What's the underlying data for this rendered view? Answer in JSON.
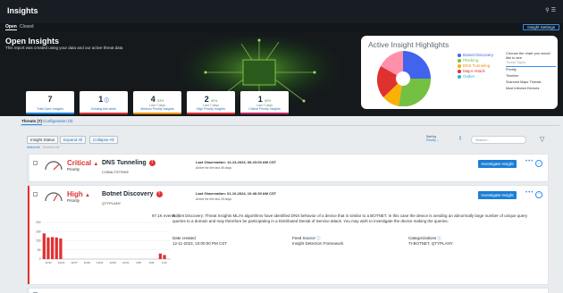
{
  "app": {
    "title": "Insights"
  },
  "header": {
    "settings_label": "Insight Settings",
    "icons": [
      "search-icon",
      "menu-icon"
    ]
  },
  "tabs": [
    {
      "label": "Open"
    },
    {
      "label": "Closed"
    }
  ],
  "hero": {
    "title": "Open Insights",
    "subtitle": "This report was created using your data and our active threat data"
  },
  "kpis": [
    {
      "value": "7",
      "delta": "",
      "delta_sub": "",
      "label": "Total Open Insights",
      "color": "#1c7ed6",
      "icon": ""
    },
    {
      "value": "1",
      "delta": "",
      "delta_sub": "",
      "label": "Existing this week",
      "color": "#e03131",
      "icon": "info-icon"
    },
    {
      "value": "4",
      "delta": "83%",
      "delta_sub": "Last 7 days",
      "label": "Medium Priority Insights",
      "color": "#f08c00",
      "icon": ""
    },
    {
      "value": "2",
      "delta": "60%",
      "delta_sub": "Last 7 days",
      "label": "High Priority Insights",
      "color": "#e03131",
      "icon": ""
    },
    {
      "value": "1",
      "delta": "60%",
      "delta_sub": "Last 7 days",
      "label": "Critical Priority Insights",
      "color": "#c2255c",
      "icon": ""
    }
  ],
  "highlights": {
    "title": "Active Insight Highlights",
    "legend": [
      {
        "label": "Botnet Discovery",
        "color": "#4263eb"
      },
      {
        "label": "Phishing",
        "color": "#74c042"
      },
      {
        "label": "DNS Tunneling",
        "color": "#fab005"
      },
      {
        "label": "Major Attack",
        "color": "#e03131"
      },
      {
        "label": "Outlier",
        "color": "#22b8cf"
      }
    ],
    "chooser_title": "Choose the chart you would like to see",
    "chooser_options": [
      "Threat Types",
      "Priority",
      "Timeline",
      "Scanned Major Threats",
      "Most Infected Devices"
    ],
    "selected": "Threat Types"
  },
  "filters": {
    "tabs": [
      "Threats (7)",
      "Configuration (0)"
    ],
    "buttons": [
      "Insight Status",
      "Expand All",
      "Collapse All"
    ],
    "links": [
      "Select All",
      "Deselect All"
    ],
    "sort_label": "Sort by",
    "sort_value": "Priority",
    "search_placeholder": "Search..."
  },
  "insights": [
    {
      "severity": "Critical",
      "priority_label": "Priority",
      "title": "DNS Tunneling",
      "tag": "COBALTSTRIKE",
      "observation": "Last Observation: 12-13-2023, 06:23:00 AM CST",
      "active": "Active for the last 40 days",
      "action": "Investigate Insight",
      "color": "#e03131"
    },
    {
      "severity": "High",
      "priority_label": "Priority",
      "title": "Botnet Discovery",
      "tag": "QTYPLANY",
      "observation": "Last Observation: 01-10-2024, 10:46:30 AM CST",
      "active": "Active for the last 29 days",
      "action": "Investigate Insight",
      "color": "#e03131",
      "events": "97.1K events",
      "description": "Botnet Discovery: Threat Insights ML/AI algorithms have identified DNS behavior of a device that is similar to a BOTNET. In this case the device is sending an abnormally large number of unique query queries to a domain and may therefore be participating in a Distributed Denial of Service attack. You may wish to investigate the device making the queries.",
      "date_created_label": "Date created",
      "date_created": "12-11-2023, 10:00:00 PM CST",
      "feed_source_label": "Feed Source",
      "feed_source": "Insight Detection Framework",
      "categorizations_label": "Categorizations",
      "categorizations": "TI-BOTNET, QTYPLANY"
    }
  ],
  "chart_data": {
    "type": "bar",
    "categories": [
      "12/11",
      "12/16",
      "12/17",
      "12/20",
      "12/21",
      "12/26",
      "12/31",
      "1/05",
      "1/06",
      "1/10"
    ],
    "tick_labels_y": [
      "200",
      "150",
      "100",
      "50",
      "0"
    ],
    "ylim": [
      0,
      200
    ],
    "values": [
      140,
      118,
      120,
      118,
      112,
      0,
      0,
      0,
      0,
      0,
      0,
      0,
      0,
      0,
      0,
      0,
      0,
      0,
      0,
      0,
      0,
      0,
      0,
      0,
      0,
      0,
      0,
      0,
      30,
      22,
      0
    ],
    "series_color": "#e03131"
  }
}
